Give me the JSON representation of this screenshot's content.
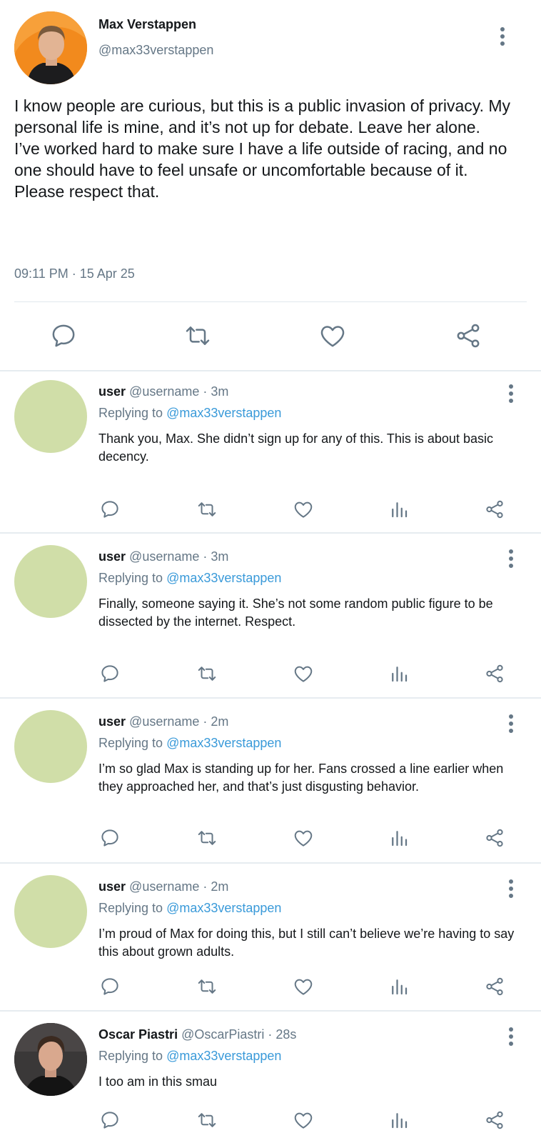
{
  "main_tweet": {
    "name": "Max Verstappen",
    "handle": "@max33verstappen",
    "body_lines": [
      "I know people are curious, but this is a public invasion of privacy. My personal life is mine, and it’s not up for debate. Leave her alone.",
      "I’ve worked hard to make sure I have a life outside of racing, and no one should have to feel unsafe or uncomfortable because of it.",
      "Please respect that."
    ],
    "timestamp": "09:11 PM · 15 Apr 25",
    "actions": [
      "reply-icon",
      "retweet-icon",
      "like-icon",
      "share-icon"
    ]
  },
  "replies": [
    {
      "name": "user",
      "handle": "@username",
      "time": "· 3m",
      "replying_label": "Replying to",
      "replying_to": "@max33verstappen",
      "text": "Thank you, Max. She didn’t sign up for any of this. This is about basic decency."
    },
    {
      "name": "user",
      "handle": "@username",
      "time": "· 3m",
      "replying_label": "Replying to",
      "replying_to": "@max33verstappen",
      "text": "Finally, someone saying it. She’s not some random public figure to be dissected by the internet. Respect."
    },
    {
      "name": "user",
      "handle": "@username",
      "time": "· 2m",
      "replying_label": "Replying to",
      "replying_to": "@max33verstappen",
      "text": "I’m so glad Max is standing up for her. Fans crossed a line earlier when they approached her, and that’s just disgusting behavior."
    },
    {
      "name": "user",
      "handle": "@username",
      "time": "· 2m",
      "replying_label": "Replying to",
      "replying_to": "@max33verstappen",
      "text": "I’m proud of Max for doing this, but I still can’t believe we’re having to say this about grown adults."
    },
    {
      "name": "Oscar Piastri",
      "handle": "@OscarPiastri",
      "time": "· 28s",
      "replying_label": "Replying to",
      "replying_to": "@max33verstappen",
      "text": "I too am in this smau"
    }
  ],
  "colors": {
    "text": "#14171a",
    "secondary": "#657786",
    "mention": "#3a9ad9",
    "placeholder_avatar": "#d0dea8",
    "divider": "#e6ecf0"
  }
}
